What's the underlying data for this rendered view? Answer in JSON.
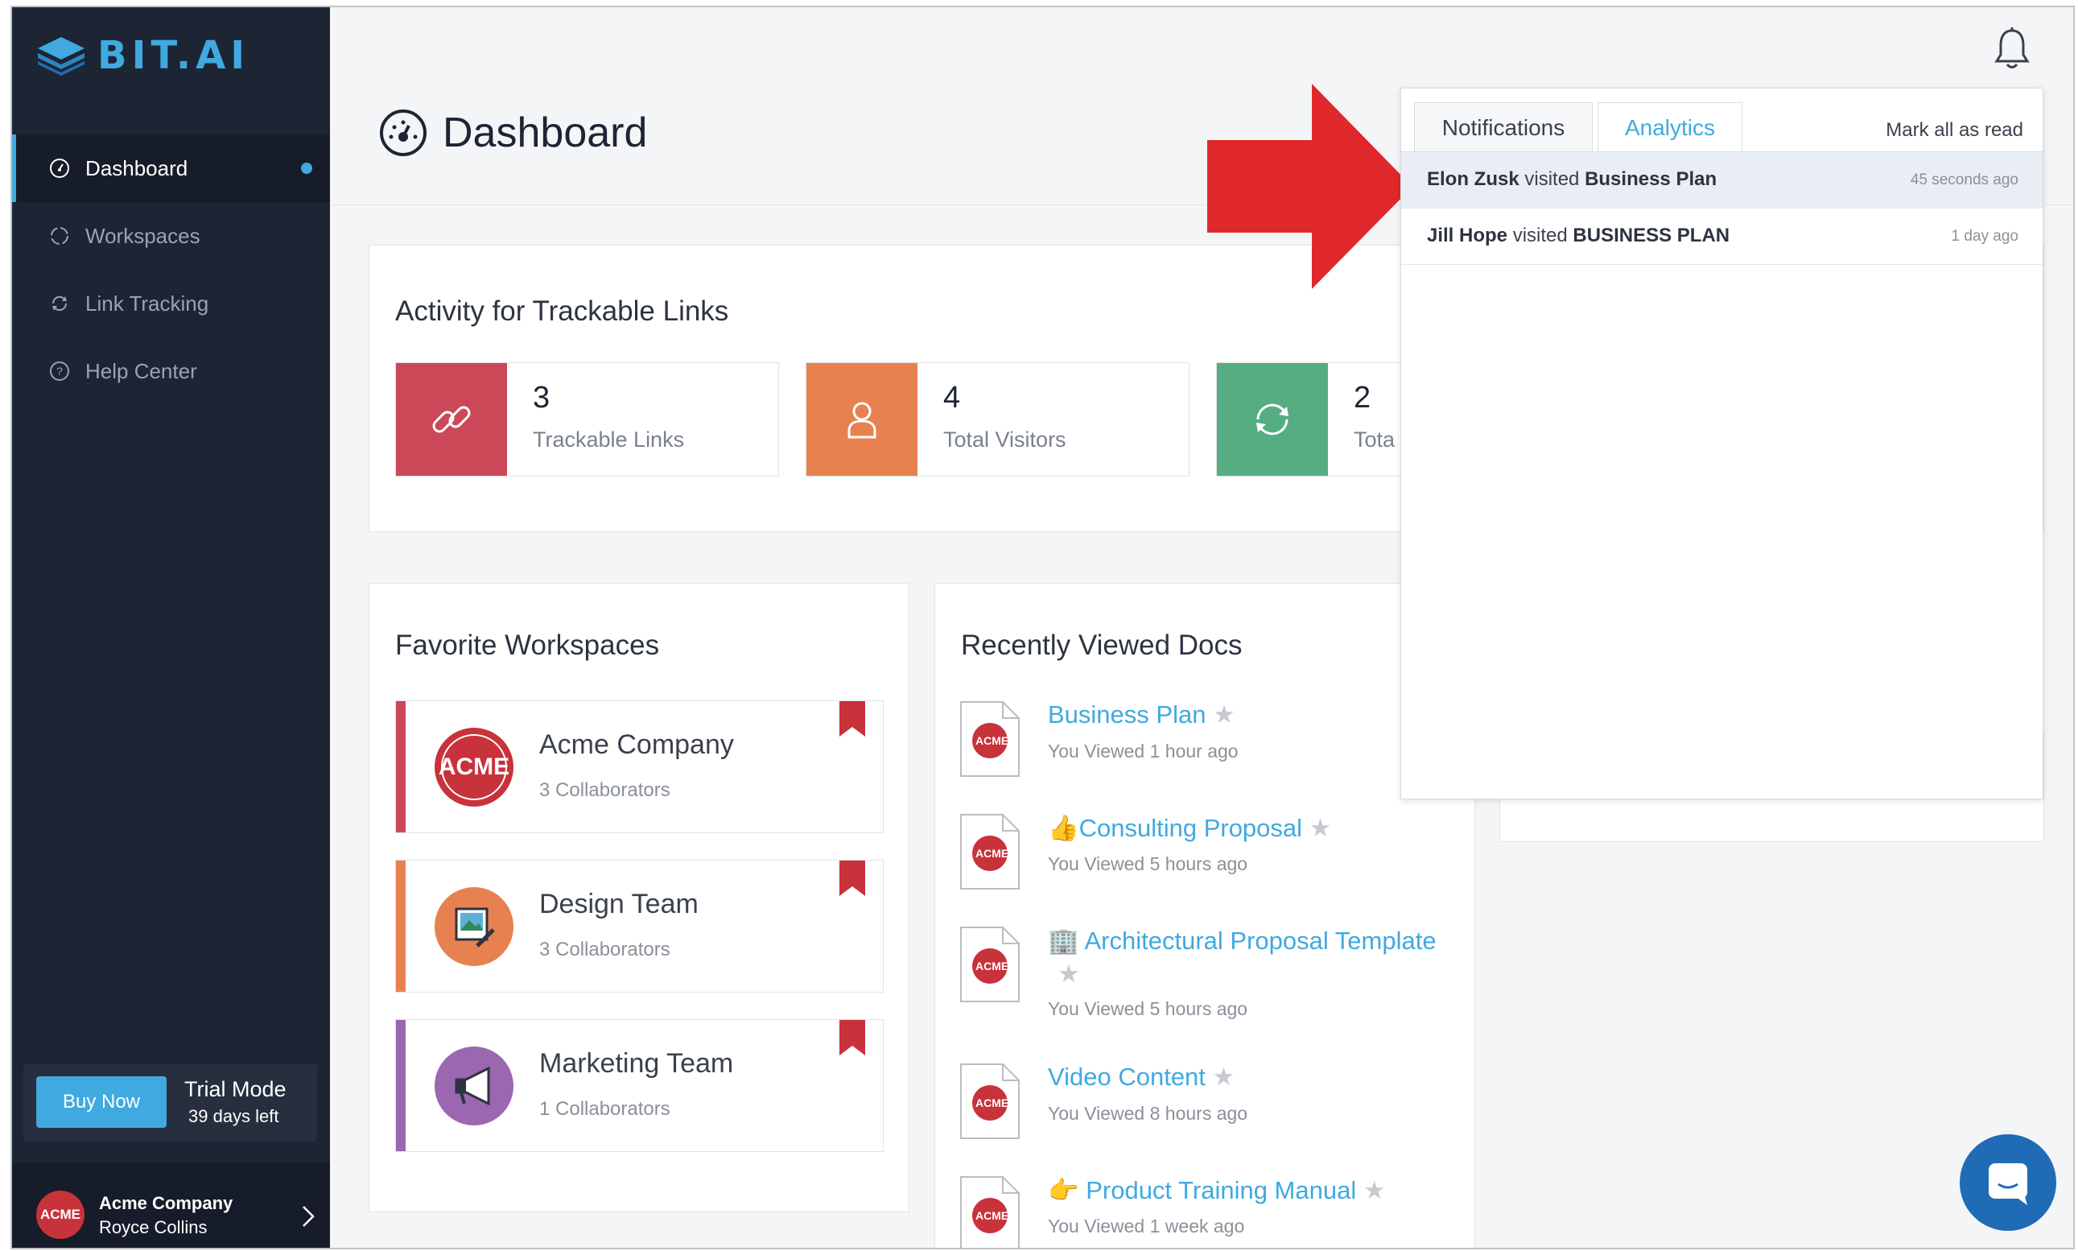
{
  "brand": {
    "logo_text": "BIT.AI"
  },
  "sidebar": {
    "items": [
      {
        "label": "Dashboard",
        "icon": "dashboard-icon",
        "active": true
      },
      {
        "label": "Workspaces",
        "icon": "workspaces-icon"
      },
      {
        "label": "Link Tracking",
        "icon": "link-tracking-icon"
      },
      {
        "label": "Help Center",
        "icon": "help-icon"
      }
    ],
    "trial": {
      "buy_label": "Buy Now",
      "title": "Trial Mode",
      "days_left": "39 days left"
    },
    "user": {
      "company": "Acme Company",
      "name": "Royce Collins",
      "avatar_text": "ACME"
    }
  },
  "header": {
    "title": "Dashboard"
  },
  "activity": {
    "title": "Activity for Trackable Links",
    "stats": [
      {
        "value": "3",
        "label": "Trackable Links",
        "color": "#cc4858",
        "icon": "link-icon"
      },
      {
        "value": "4",
        "label": "Total Visitors",
        "color": "#e88150",
        "icon": "user-icon"
      },
      {
        "value": "2",
        "label": "Tota",
        "color": "#56ad82",
        "icon": "refresh-icon"
      }
    ]
  },
  "favorites": {
    "title": "Favorite Workspaces",
    "items": [
      {
        "name": "Acme Company",
        "collaborators": "3 Collaborators",
        "color": "#cc4858",
        "avatar_text": "ACME"
      },
      {
        "name": "Design Team",
        "collaborators": "3 Collaborators",
        "color": "#e88150",
        "avatar_text": ""
      },
      {
        "name": "Marketing Team",
        "collaborators": "1 Collaborators",
        "color": "#9b67b0",
        "avatar_text": ""
      }
    ]
  },
  "recent": {
    "title": "Recently Viewed Docs",
    "docs": [
      {
        "name": "Business Plan",
        "viewed": "You Viewed 1 hour ago"
      },
      {
        "name": "👍Consulting Proposal",
        "viewed": "You Viewed 5 hours ago"
      },
      {
        "name": "🏢 Architectural Proposal Template",
        "viewed": "You Viewed 5 hours ago"
      },
      {
        "name": "Video Content",
        "viewed": "You Viewed 8 hours ago"
      },
      {
        "name": "👉 Product Training Manual",
        "viewed": "You Viewed 1 week ago"
      }
    ],
    "file_badge": "ACME"
  },
  "notifications": {
    "tabs": [
      "Notifications",
      "Analytics"
    ],
    "active_tab": "Analytics",
    "mark_all": "Mark all as read",
    "items": [
      {
        "user": "Elon Zusk",
        "verb": "visited",
        "doc": "Business Plan",
        "time": "45 seconds ago",
        "highlighted": true
      },
      {
        "user": "Jill Hope",
        "verb": "visited",
        "doc": "BUSINESS PLAN",
        "time": "1 day ago",
        "highlighted": false
      }
    ]
  },
  "colors": {
    "accent": "#3fa9e0",
    "sidebar_bg": "#1d2433",
    "arrow": "#e0282c"
  }
}
